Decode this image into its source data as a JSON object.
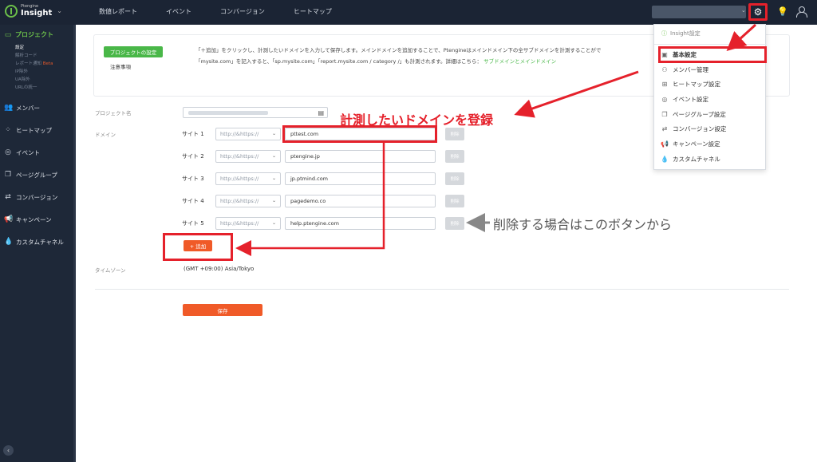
{
  "app": {
    "logo_sub": "Ptengine",
    "logo_main": "Insight"
  },
  "topnav": [
    "数値レポート",
    "イベント",
    "コンバージョン",
    "ヒートマップ"
  ],
  "sidebar": {
    "project_label": "プロジェクト",
    "sub_items": [
      "設定",
      "解析コード",
      "レポート通知",
      "IP除外",
      "UA除外",
      "URLの統一"
    ],
    "beta": "Beta",
    "items": [
      {
        "icon": "members-icon",
        "label": "メンバー"
      },
      {
        "icon": "heatmap-icon",
        "label": "ヒートマップ"
      },
      {
        "icon": "event-icon",
        "label": "イベント"
      },
      {
        "icon": "page-group-icon",
        "label": "ページグループ"
      },
      {
        "icon": "conversion-icon",
        "label": "コンバージョン"
      },
      {
        "icon": "campaign-icon",
        "label": "キャンペーン"
      },
      {
        "icon": "custom-channel-icon",
        "label": "カスタムチャネル"
      }
    ]
  },
  "settings_box": {
    "pill": "プロジェクトの設定",
    "notes": "注意事項",
    "info_line1": "「＋追加」をクリックし、計測したいドメインを入力して保存します。メインドメインを追加することで、Ptengineはメインドメイン下の全サブドメインを計測することがで",
    "info_line2": "「mysite.com」を記入すると、「sp.mysite.com」「report.mysite.com / category /」も計測されます。詳細はこちら：",
    "info_link": "サブドメインとメインドメイン"
  },
  "form": {
    "project_name_label": "プロジェクト名",
    "domain_label": "ドメイン",
    "timezone_label": "タイムゾーン",
    "timezone_value": "(GMT +09:00) Asia/Tokyo",
    "protocol_value": "http://&https://",
    "delete_label": "削除",
    "add_label": "+ 追加",
    "save_label": "保存",
    "sites": [
      {
        "label": "サイト 1",
        "domain": "pttest.com"
      },
      {
        "label": "サイト 2",
        "domain": "ptengine.jp"
      },
      {
        "label": "サイト 3",
        "domain": "jp.ptmind.com"
      },
      {
        "label": "サイト 4",
        "domain": "pagedemo.co"
      },
      {
        "label": "サイト 5",
        "domain": "help.ptengine.com"
      }
    ]
  },
  "dropdown": {
    "header": "Insight設定",
    "items": [
      {
        "icon": "basic-settings-icon",
        "label": "基本設定"
      },
      {
        "icon": "member-mgmt-icon",
        "label": "メンバー管理"
      },
      {
        "icon": "heatmap-settings-icon",
        "label": "ヒートマップ設定"
      },
      {
        "icon": "event-settings-icon",
        "label": "イベント設定"
      },
      {
        "icon": "page-group-settings-icon",
        "label": "ページグループ設定"
      },
      {
        "icon": "conversion-settings-icon",
        "label": "コンバージョン設定"
      },
      {
        "icon": "campaign-settings-icon",
        "label": "キャンペーン設定"
      },
      {
        "icon": "custom-channel-settings-icon",
        "label": "カスタムチャネル"
      }
    ]
  },
  "annotations": {
    "register_domain": "計測したいドメインを登録",
    "delete_hint": "削除する場合はこのボタンから"
  },
  "colors": {
    "accent_green": "#49b748",
    "accent_orange": "#f05a28",
    "annotation_red": "#e5212b"
  }
}
